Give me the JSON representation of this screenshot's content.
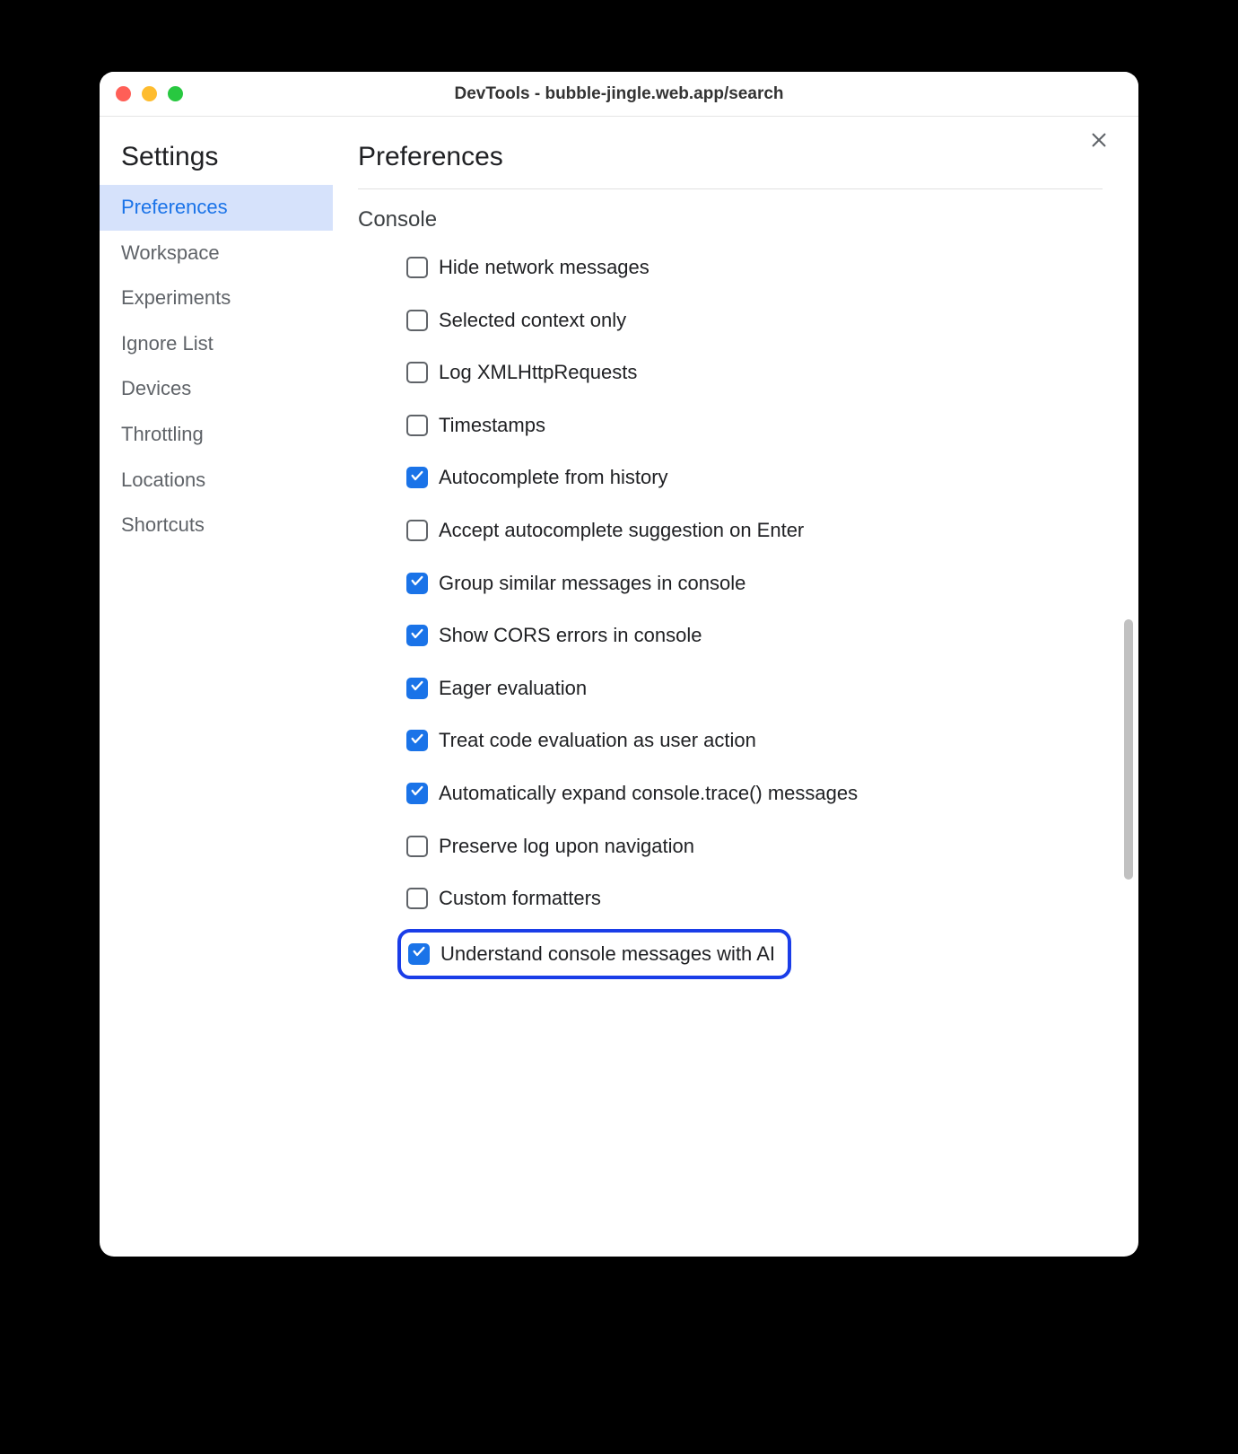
{
  "window": {
    "title": "DevTools - bubble-jingle.web.app/search"
  },
  "sidebar": {
    "title": "Settings",
    "items": [
      {
        "label": "Preferences",
        "active": true
      },
      {
        "label": "Workspace",
        "active": false
      },
      {
        "label": "Experiments",
        "active": false
      },
      {
        "label": "Ignore List",
        "active": false
      },
      {
        "label": "Devices",
        "active": false
      },
      {
        "label": "Throttling",
        "active": false
      },
      {
        "label": "Locations",
        "active": false
      },
      {
        "label": "Shortcuts",
        "active": false
      }
    ]
  },
  "main": {
    "title": "Preferences",
    "section": "Console",
    "options": [
      {
        "label": "Hide network messages",
        "checked": false,
        "highlighted": false
      },
      {
        "label": "Selected context only",
        "checked": false,
        "highlighted": false
      },
      {
        "label": "Log XMLHttpRequests",
        "checked": false,
        "highlighted": false
      },
      {
        "label": "Timestamps",
        "checked": false,
        "highlighted": false
      },
      {
        "label": "Autocomplete from history",
        "checked": true,
        "highlighted": false
      },
      {
        "label": "Accept autocomplete suggestion on Enter",
        "checked": false,
        "highlighted": false
      },
      {
        "label": "Group similar messages in console",
        "checked": true,
        "highlighted": false
      },
      {
        "label": "Show CORS errors in console",
        "checked": true,
        "highlighted": false
      },
      {
        "label": "Eager evaluation",
        "checked": true,
        "highlighted": false
      },
      {
        "label": "Treat code evaluation as user action",
        "checked": true,
        "highlighted": false
      },
      {
        "label": "Automatically expand console.trace() messages",
        "checked": true,
        "highlighted": false
      },
      {
        "label": "Preserve log upon navigation",
        "checked": false,
        "highlighted": false
      },
      {
        "label": "Custom formatters",
        "checked": false,
        "highlighted": false
      },
      {
        "label": "Understand console messages with AI",
        "checked": true,
        "highlighted": true
      }
    ]
  }
}
